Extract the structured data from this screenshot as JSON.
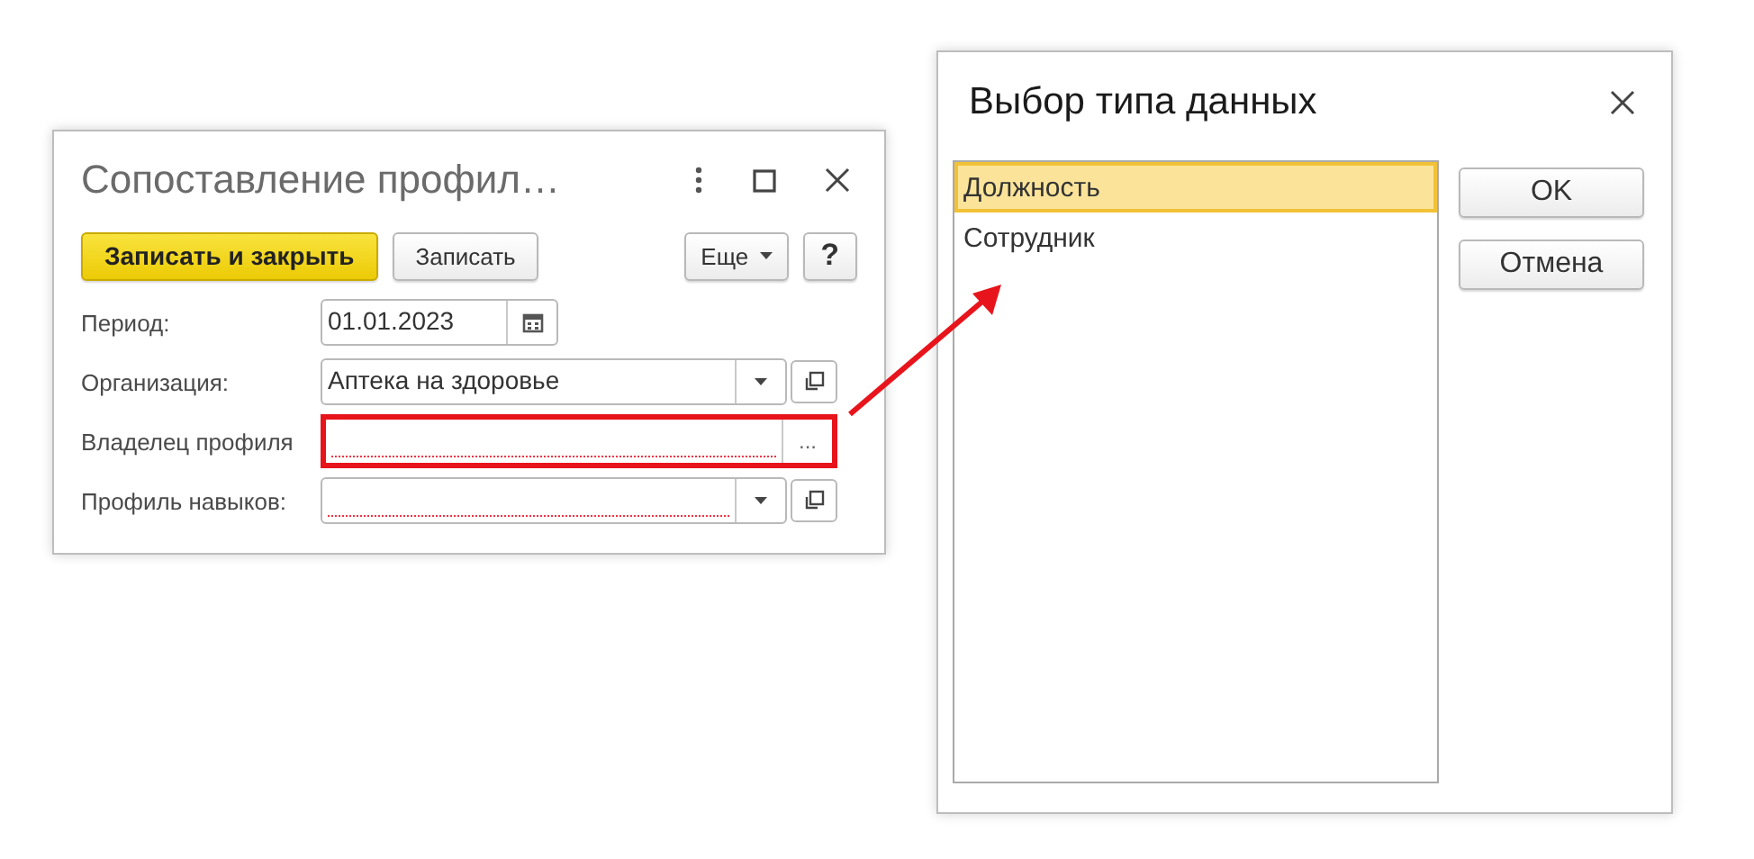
{
  "form_window": {
    "title": "Сопоставление профил…",
    "toolbar": [
      {
        "label": "Записать и закрыть",
        "kind": "primary"
      },
      {
        "label": "Записать",
        "kind": "normal"
      },
      {
        "label": "Еще",
        "kind": "menu"
      },
      {
        "label": "?",
        "kind": "help"
      }
    ],
    "fields": [
      {
        "label": "Период:",
        "value": "01.01.2023",
        "kind": "date",
        "required": false,
        "highlighted": false
      },
      {
        "label": "Организация:",
        "value": "Аптека на здоровье",
        "kind": "select",
        "required": false,
        "highlighted": false
      },
      {
        "label": "Владелец профиля",
        "kind": "choice",
        "choice_button": "...",
        "required": true,
        "highlighted": true
      },
      {
        "label": "Профиль навыков:",
        "kind": "select",
        "required": true,
        "highlighted": false
      }
    ]
  },
  "type_dialog": {
    "title": "Выбор типа данных",
    "items": [
      {
        "label": "Должность",
        "selected": true
      },
      {
        "label": "Сотрудник",
        "selected": false
      }
    ],
    "buttons": [
      "OK",
      "Отмена"
    ]
  }
}
